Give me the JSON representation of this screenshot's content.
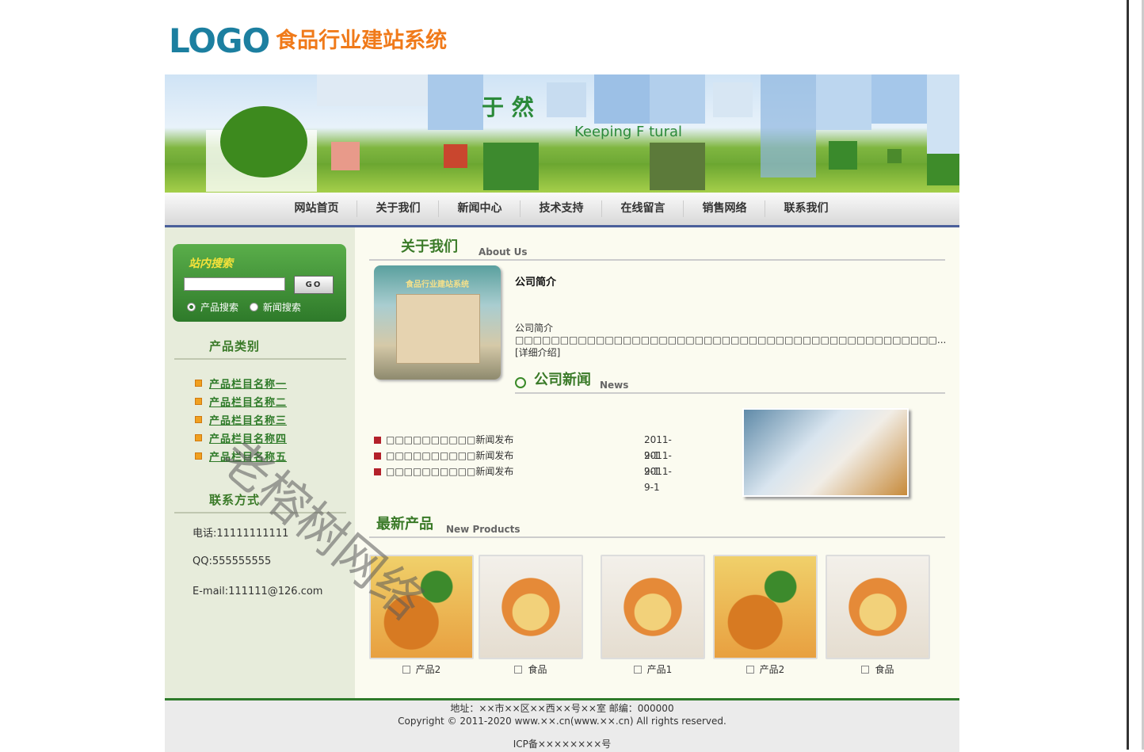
{
  "header": {
    "logo_text": "LOGO",
    "site_title": "食品行业建站系统"
  },
  "banner": {
    "slogan_cn": "于 然",
    "slogan_en": "Keeping F        tural"
  },
  "nav": [
    "网站首页",
    "关于我们",
    "新闻中心",
    "技术支持",
    "在线留言",
    "销售网络",
    "联系我们"
  ],
  "search": {
    "title": "站内搜索",
    "input_value": "",
    "button": "GO",
    "option_product": "产品搜索",
    "option_news": "新闻搜索",
    "selected": "产品搜索"
  },
  "categories": {
    "title": "产品类别",
    "items": [
      "产品栏目名称一",
      "产品栏目名称二",
      "产品栏目名称三",
      "产品栏目名称四",
      "产品栏目名称五"
    ]
  },
  "contact": {
    "title": "联系方式",
    "phone": "电话:11111111111",
    "qq": "QQ:555555555",
    "email": "E-mail:111111@126.com"
  },
  "about": {
    "title_cn": "关于我们",
    "title_en": "About Us",
    "image_caption": "食品行业建站系统",
    "heading": "公司简介",
    "text": "公司简介□□□□□□□□□□□□□□□□□□□□□□□□□□□□□□□□□□□□□□□□□□□□□□□... [详细介绍]"
  },
  "news": {
    "title_cn": "公司新闻",
    "title_en": "News",
    "items": [
      {
        "title": "□□□□□□□□□□新闻发布",
        "date": "2011-9-1"
      },
      {
        "title": "□□□□□□□□□□新闻发布",
        "date": "2011-9-1"
      },
      {
        "title": "□□□□□□□□□□新闻发布",
        "date": "2011-9-1"
      }
    ]
  },
  "products": {
    "title_cn": "最新产品",
    "title_en": "New Products",
    "items": [
      {
        "name": "产品2",
        "image": "fried"
      },
      {
        "name": "食品",
        "image": "soup"
      },
      {
        "name": "产品1",
        "image": "soup"
      },
      {
        "name": "产品2",
        "image": "fried"
      },
      {
        "name": "食品",
        "image": "soup"
      }
    ]
  },
  "footer": {
    "address": "地址：××市××区××西××号××室  邮编：000000",
    "copyright": "Copyright © 2011-2020 www.××.cn(www.××.cn) All rights reserved.",
    "icp": "ICP备××××××××号"
  },
  "watermark": "老榕树网络"
}
